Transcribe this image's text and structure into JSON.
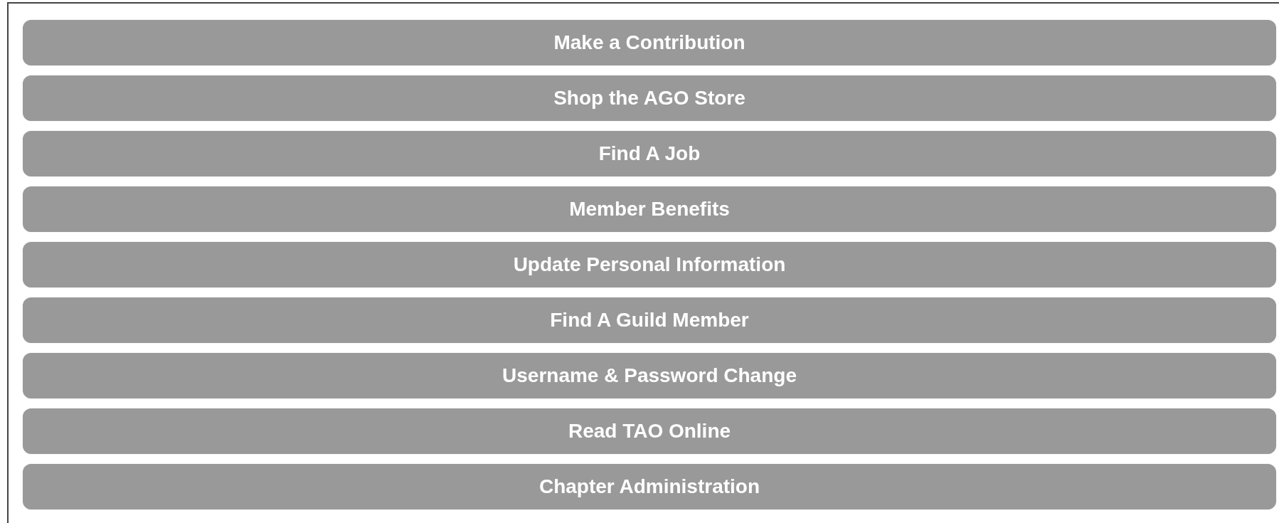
{
  "links": [
    {
      "label": "Make a Contribution"
    },
    {
      "label": "Shop the AGO Store"
    },
    {
      "label": "Find A Job"
    },
    {
      "label": "Member Benefits"
    },
    {
      "label": "Update Personal Information"
    },
    {
      "label": "Find A Guild Member"
    },
    {
      "label": "Username & Password Change"
    },
    {
      "label": "Read TAO Online"
    },
    {
      "label": "Chapter Administration"
    }
  ]
}
